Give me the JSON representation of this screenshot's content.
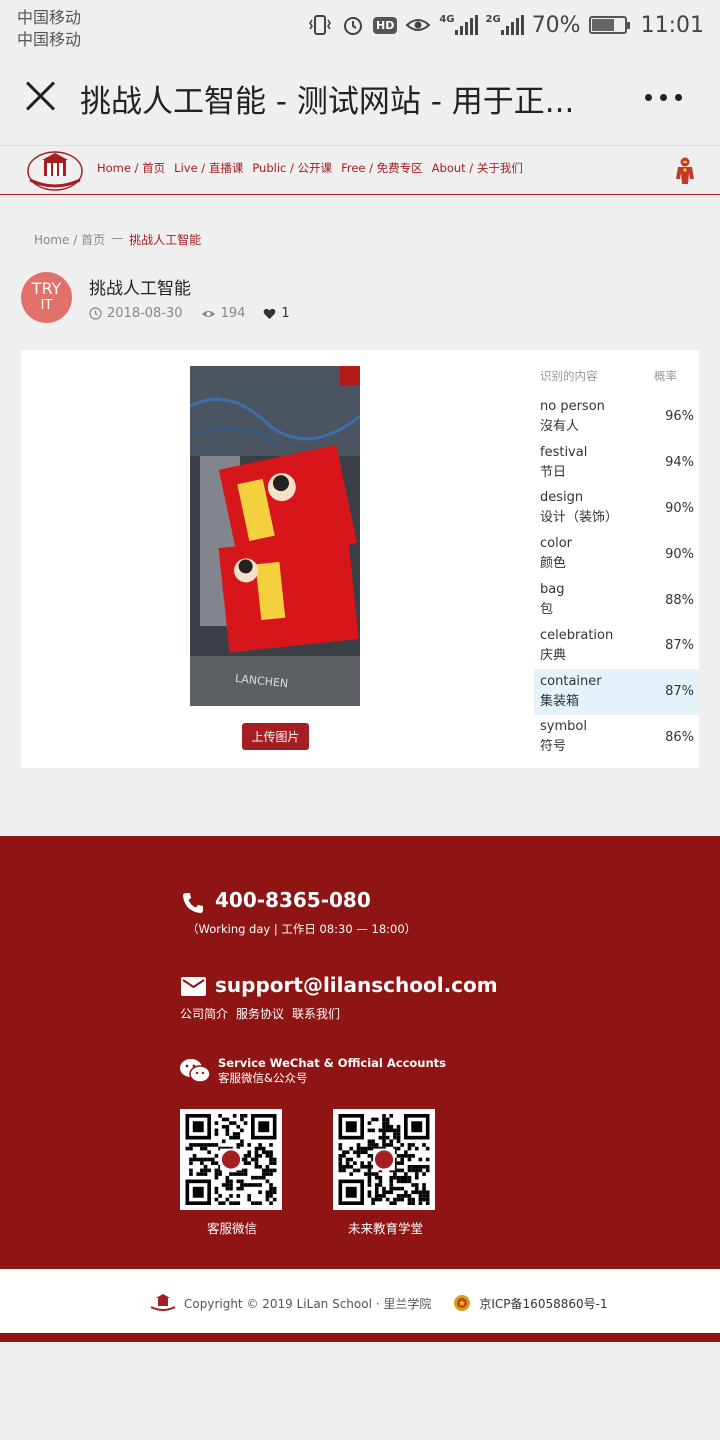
{
  "status_bar": {
    "carrier_1": "中国移动",
    "carrier_2": "中国移动",
    "hd": "HD",
    "net_1": "4G",
    "net_2": "2G",
    "battery": "70%",
    "battery_level": 0.7,
    "time": "11:01"
  },
  "app_bar": {
    "title": "挑战人工智能 - 测试网站 - 用于正..."
  },
  "nav": {
    "items": [
      "Home / 首页",
      "Live / 直播课",
      "Public / 公开课",
      "Free / 免费专区",
      "About / 关于我们"
    ]
  },
  "breadcrumb": {
    "home": "Home / 首页",
    "sep": "—",
    "current": "挑战人工智能"
  },
  "post": {
    "avatar_line1": "TRY",
    "avatar_line2": "IT",
    "title": "挑战人工智能",
    "date": "2018-08-30",
    "views": "194",
    "likes": "1"
  },
  "results": {
    "upload_label": "上传图片",
    "photo_text": "LANCHEN",
    "col_content": "识别的内容",
    "col_prob": "概率",
    "rows": [
      {
        "en": "no person",
        "zh": "沒有人",
        "prob": "96%"
      },
      {
        "en": "festival",
        "zh": "节日",
        "prob": "94%"
      },
      {
        "en": "design",
        "zh": "设计（装饰）",
        "prob": "90%"
      },
      {
        "en": "color",
        "zh": "颜色",
        "prob": "90%"
      },
      {
        "en": "bag",
        "zh": "包",
        "prob": "88%"
      },
      {
        "en": "celebration",
        "zh": "庆典",
        "prob": "87%"
      },
      {
        "en": "container",
        "zh": "集装箱",
        "prob": "87%"
      },
      {
        "en": "symbol",
        "zh": "符号",
        "prob": "86%"
      }
    ],
    "highlight_color": "#e6f2fa"
  },
  "footer": {
    "phone": "400-8365-080",
    "hours": "（Working day | 工作日 08:30 — 18:00）",
    "email": "support@lilanschool.com",
    "links": [
      "公司简介",
      "服务协议",
      "联系我们"
    ],
    "wechat_title": "Service WeChat & Official Accounts",
    "wechat_sub": "客服微信&公众号",
    "qr_caption_1": "客服微信",
    "qr_caption_2": "未来教育学堂"
  },
  "bottom": {
    "copyright": "Copyright © 2019  LiLan School · 里兰学院",
    "icp": "京ICP备16058860号-1"
  },
  "colors": {
    "brand": "#a51e22",
    "footer_bg": "#8f1515",
    "avatar_bg": "#e2716c"
  }
}
